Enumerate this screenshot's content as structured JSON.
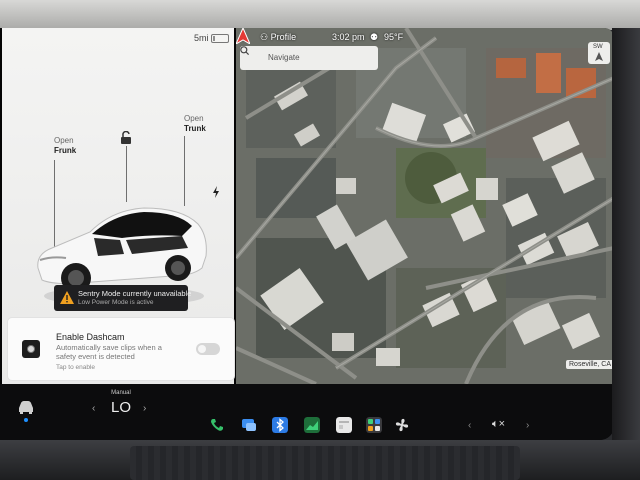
{
  "battery": {
    "range": "5mi",
    "level_fraction": 0.15
  },
  "car_panel": {
    "frunk": {
      "action": "Open",
      "label": "Frunk"
    },
    "trunk": {
      "action": "Open",
      "label": "Trunk"
    },
    "sentry": {
      "title": "Sentry Mode currently unavailable",
      "subtitle": "Low Power Mode is active"
    },
    "dashcam": {
      "title": "Enable Dashcam",
      "description": "Automatically save clips when a safety event is detected",
      "tap": "Tap to enable",
      "enabled": false
    }
  },
  "status_bar": {
    "profile": "Profile",
    "time": "3:02 pm",
    "temperature": "95°F"
  },
  "map": {
    "search_placeholder": "Navigate",
    "compass": "SW",
    "location": "Roseville, CA"
  },
  "dock": {
    "climate_mode": "Manual",
    "climate_value": "LO",
    "volume_icon": "volume-muted-icon",
    "apps": [
      "phone-icon",
      "messages-icon",
      "bluetooth-icon",
      "energy-icon",
      "calendar-icon",
      "apps-icon",
      "fan-icon"
    ]
  },
  "colors": {
    "accent": "#1e90ff",
    "warning": "#f0a020",
    "nav_arrow": "#e53935",
    "map_base": "#6b6e67"
  }
}
